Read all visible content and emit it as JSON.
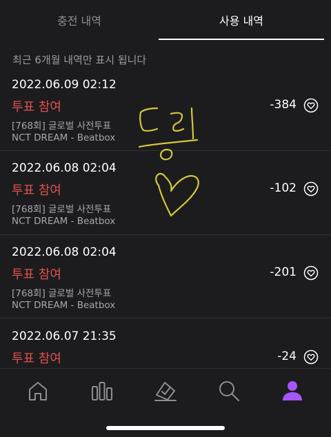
{
  "tabs": {
    "charge_history": "충전 내역",
    "usage_history": "사용 내역"
  },
  "notice": "최근 6개월 내역만 표시 됩니다",
  "items": [
    {
      "date": "2022.06.09 02:12",
      "type": "투표 참여",
      "desc1": "[768회] 글로벌 사전투표",
      "desc2": "NCT DREAM - Beatbox",
      "amount": "-384"
    },
    {
      "date": "2022.06.08 02:04",
      "type": "투표 참여",
      "desc1": "[768회] 글로벌 사전투표",
      "desc2": "NCT DREAM - Beatbox",
      "amount": "-102"
    },
    {
      "date": "2022.06.08 02:04",
      "type": "투표 참여",
      "desc1": "[768회] 글로벌 사전투표",
      "desc2": "NCT DREAM - Beatbox",
      "amount": "-201"
    },
    {
      "date": "2022.06.07 21:35",
      "type": "투표 참여",
      "desc1": "",
      "desc2": "",
      "amount": "-24"
    }
  ],
  "nav": {
    "icons": [
      "home-icon",
      "chart-icon",
      "vote-icon",
      "search-icon",
      "profile-icon"
    ],
    "active": "profile-icon",
    "active_color": "#a855f7",
    "inactive_color": "#8e8e93"
  },
  "colors": {
    "background": "#1c1c1e",
    "vote_text": "#e0504a",
    "scribble": "#d4c93a"
  }
}
